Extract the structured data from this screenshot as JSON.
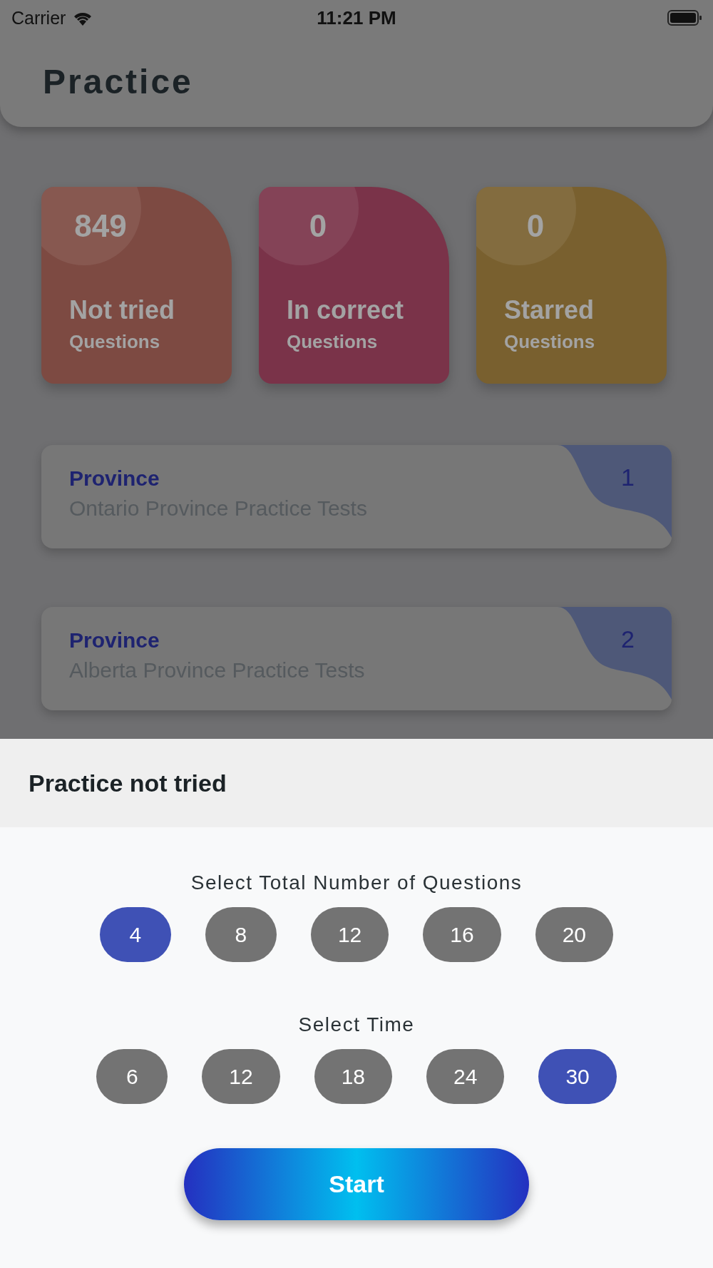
{
  "status_bar": {
    "carrier": "Carrier",
    "time": "11:21 PM"
  },
  "header": {
    "title": "Practice"
  },
  "stats": [
    {
      "value": "849",
      "label": "Not tried",
      "sublabel": "Questions",
      "color": "#7d4a42"
    },
    {
      "value": "0",
      "label": "In correct",
      "sublabel": "Questions",
      "color": "#7a3349"
    },
    {
      "value": "0",
      "label": "Starred",
      "sublabel": "Questions",
      "color": "#79602f"
    }
  ],
  "provinces": [
    {
      "category": "Province",
      "title": "Ontario Province Practice Tests",
      "number": "1"
    },
    {
      "category": "Province",
      "title": "Alberta Province Practice Tests",
      "number": "2"
    }
  ],
  "sheet": {
    "title": "Practice not tried",
    "question_count": {
      "label": "Select Total Number of Questions",
      "options": [
        {
          "label": "4",
          "selected": true
        },
        {
          "label": "8",
          "selected": false
        },
        {
          "label": "12",
          "selected": false
        },
        {
          "label": "16",
          "selected": false
        },
        {
          "label": "20",
          "selected": false
        }
      ]
    },
    "time": {
      "label": "Select Time",
      "options": [
        {
          "label": "6",
          "selected": false
        },
        {
          "label": "12",
          "selected": false
        },
        {
          "label": "18",
          "selected": false
        },
        {
          "label": "24",
          "selected": false
        },
        {
          "label": "30",
          "selected": true
        }
      ]
    },
    "start_button": "Start"
  }
}
